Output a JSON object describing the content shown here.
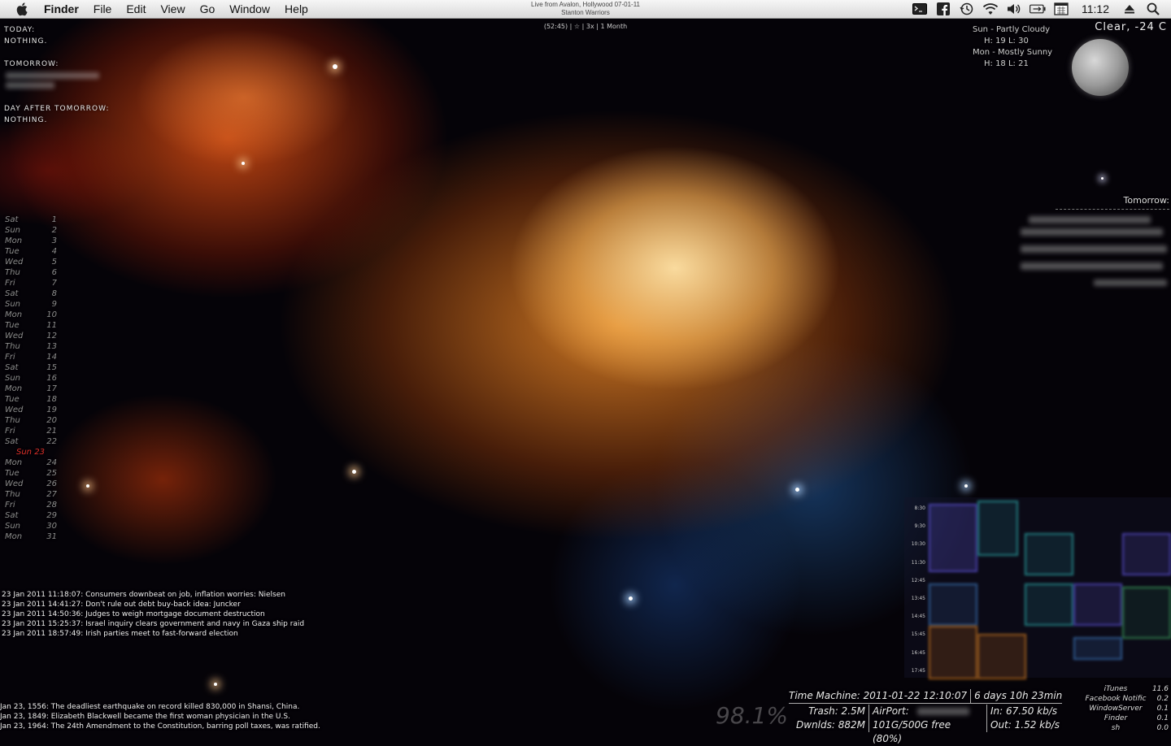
{
  "menubar": {
    "app_name": "Finder",
    "menus": [
      "File",
      "Edit",
      "View",
      "Go",
      "Window",
      "Help"
    ],
    "now_playing": {
      "line1": "Live from Avalon, Hollywood 07-01-11",
      "line2": "Stanton Warriors"
    },
    "clock": "11:12",
    "status_icons": [
      "terminal-icon",
      "facebook-icon",
      "time-machine-icon",
      "wifi-icon",
      "volume-icon",
      "battery-icon",
      "calendar-icon",
      "eject-icon",
      "spotlight-icon"
    ]
  },
  "rating_line": "(52:45) | ☆ | 3x | 1 Month",
  "agenda": {
    "today_label": "Today:",
    "today_value": "Nothing.",
    "tomorrow_label": "Tomorrow:",
    "day_after_label": "Day after tomorrow:",
    "day_after_value": "Nothing."
  },
  "weather": {
    "line1": "Sun - Partly Cloudy",
    "line2": "H: 19 L: 30",
    "line3": "Mon - Mostly Sunny",
    "line4": "H: 18 L: 21",
    "now": "Clear, -24 C",
    "tomorrow_label": "Tomorrow:"
  },
  "calendar": [
    {
      "d": "Sat",
      "n": "1"
    },
    {
      "d": "Sun",
      "n": "2"
    },
    {
      "d": "Mon",
      "n": "3"
    },
    {
      "d": "Tue",
      "n": "4"
    },
    {
      "d": "Wed",
      "n": "5"
    },
    {
      "d": "Thu",
      "n": "6"
    },
    {
      "d": "Fri",
      "n": "7"
    },
    {
      "d": "Sat",
      "n": "8"
    },
    {
      "d": "Sun",
      "n": "9"
    },
    {
      "d": "Mon",
      "n": "10"
    },
    {
      "d": "Tue",
      "n": "11"
    },
    {
      "d": "Wed",
      "n": "12"
    },
    {
      "d": "Thu",
      "n": "13"
    },
    {
      "d": "Fri",
      "n": "14"
    },
    {
      "d": "Sat",
      "n": "15"
    },
    {
      "d": "Sun",
      "n": "16"
    },
    {
      "d": "Mon",
      "n": "17"
    },
    {
      "d": "Tue",
      "n": "18"
    },
    {
      "d": "Wed",
      "n": "19"
    },
    {
      "d": "Thu",
      "n": "20"
    },
    {
      "d": "Fri",
      "n": "21"
    },
    {
      "d": "Sat",
      "n": "22"
    },
    {
      "d": "Sun 23",
      "n": "",
      "today": true
    },
    {
      "d": "Mon",
      "n": "24"
    },
    {
      "d": "Tue",
      "n": "25"
    },
    {
      "d": "Wed",
      "n": "26"
    },
    {
      "d": "Thu",
      "n": "27"
    },
    {
      "d": "Fri",
      "n": "28"
    },
    {
      "d": "Sat",
      "n": "29"
    },
    {
      "d": "Sun",
      "n": "30"
    },
    {
      "d": "Mon",
      "n": "31"
    }
  ],
  "news": [
    "23 Jan 2011 11:18:07: Consumers downbeat on job, inflation worries: Nielsen",
    "23 Jan 2011 14:41:27: Don't rule out debt buy-back idea: Juncker",
    "23 Jan 2011 14:50:36: Judges to weigh mortgage document destruction",
    "23 Jan 2011 15:25:37: Israel inquiry clears government and navy in Gaza ship raid",
    "23 Jan 2011 18:57:49: Irish parties meet to fast-forward election"
  ],
  "history": [
    "Jan 23, 1556: The deadliest earthquake on record killed 830,000 in Shansi, China.",
    "Jan 23, 1849: Elizabeth Blackwell became the first woman physician in the U.S.",
    "Jan 23, 1964: The 24th Amendment to the Constitution, barring poll taxes, was ratified."
  ],
  "schedule_times": [
    "8:30",
    "9:30",
    "10:30",
    "11:30",
    "12:45",
    "13:45",
    "14:45",
    "15:45",
    "16:45",
    "17:45"
  ],
  "system": {
    "big_percent": "98.1%",
    "time_machine": "Time Machine: 2011-01-22 12:10:07",
    "uptime": "6 days 10h 23min",
    "trash": "Trash: 2.5M",
    "downloads": "Dwnlds: 882M",
    "airport": "AirPort:",
    "disk": "101G/500G free (80%)",
    "net_in": "In: 67.50 kb/s",
    "net_out": "Out: 1.52 kb/s"
  },
  "processes": [
    {
      "name": "iTunes",
      "value": "11.6"
    },
    {
      "name": "Facebook Notific",
      "value": "0.2"
    },
    {
      "name": "WindowServer",
      "value": "0.1"
    },
    {
      "name": "Finder",
      "value": "0.1"
    },
    {
      "name": "sh",
      "value": "0.0"
    }
  ]
}
